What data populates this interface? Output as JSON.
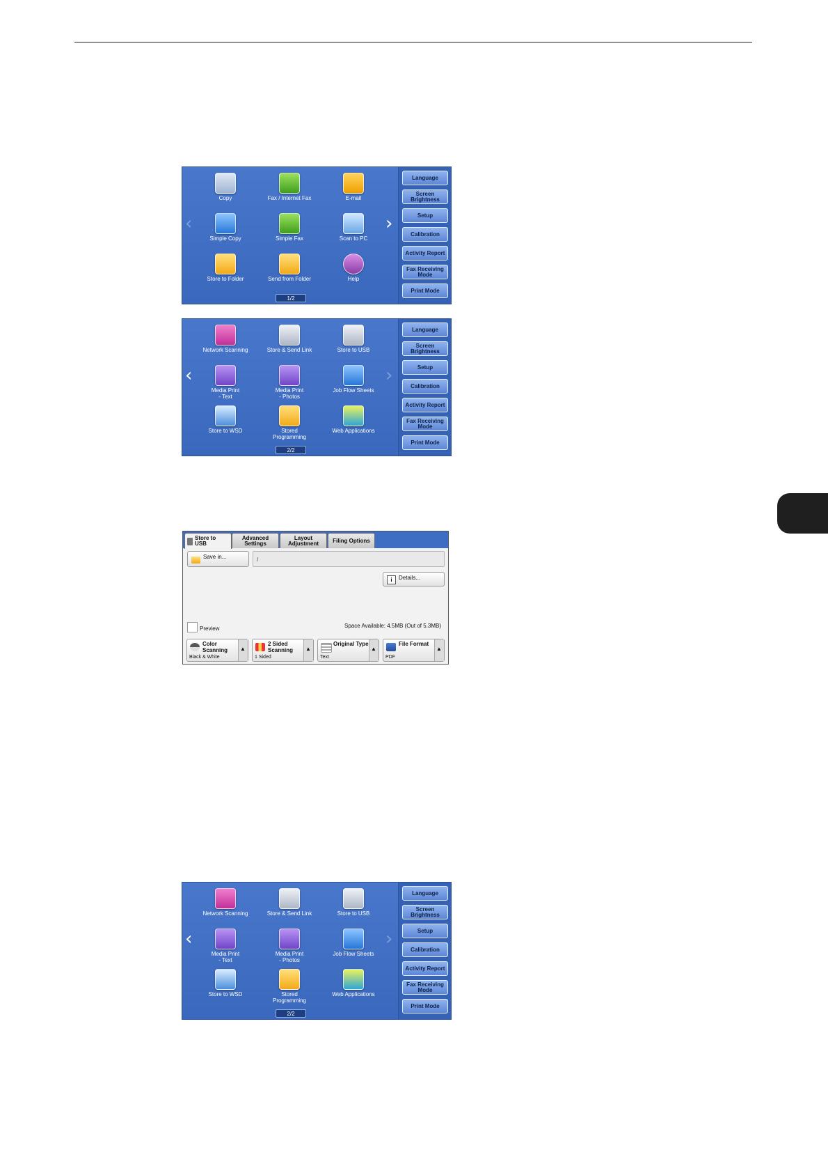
{
  "right_menu": [
    "Language",
    "Screen\nBrightness",
    "Setup",
    "Calibration",
    "Activity Report",
    "Fax Receiving\nMode",
    "Print Mode"
  ],
  "page1": {
    "apps": [
      {
        "label": "Copy",
        "icon": "copy-icon"
      },
      {
        "label": "Fax / Internet Fax",
        "icon": "fax-icon"
      },
      {
        "label": "E-mail",
        "icon": "email-icon"
      },
      {
        "label": "Simple Copy",
        "icon": "simple-copy-icon"
      },
      {
        "label": "Simple Fax",
        "icon": "simple-fax-icon"
      },
      {
        "label": "Scan to PC",
        "icon": "scan-to-pc-icon"
      },
      {
        "label": "Store to Folder",
        "icon": "folder-icon"
      },
      {
        "label": "Send from Folder",
        "icon": "send-from-folder-icon"
      },
      {
        "label": "Help",
        "icon": "help-icon"
      }
    ],
    "pager": "1/2"
  },
  "page2": {
    "apps": [
      {
        "label": "Network Scanning",
        "icon": "network-scanning-icon"
      },
      {
        "label": "Store & Send Link",
        "icon": "store-send-link-icon"
      },
      {
        "label": "Store to USB",
        "icon": "usb-icon"
      },
      {
        "label": "Media Print\n- Text",
        "icon": "media-print-text-icon"
      },
      {
        "label": "Media Print\n- Photos",
        "icon": "media-print-photos-icon"
      },
      {
        "label": "Job Flow Sheets",
        "icon": "job-flow-sheets-icon"
      },
      {
        "label": "Store to WSD",
        "icon": "wsd-icon"
      },
      {
        "label": "Stored\nProgramming",
        "icon": "stored-programming-icon"
      },
      {
        "label": "Web Applications",
        "icon": "web-applications-icon"
      }
    ],
    "pager": "2/2"
  },
  "usb_screen": {
    "tabs": [
      "Store to\nUSB",
      "Advanced\nSettings",
      "Layout\nAdjustment",
      "Filing Options"
    ],
    "save_in_label": "Save in...",
    "path_value": "/",
    "details_label": "Details...",
    "preview_label": "Preview",
    "space_available": "Space Available: 4.5MB (Out of 5.3MB)",
    "features": [
      {
        "title": "Color\nScanning",
        "value": "Black & White"
      },
      {
        "title": "2 Sided\nScanning",
        "value": "1 Sided"
      },
      {
        "title": "Original Type",
        "value": "Text"
      },
      {
        "title": "File Format",
        "value": "PDF"
      }
    ]
  }
}
